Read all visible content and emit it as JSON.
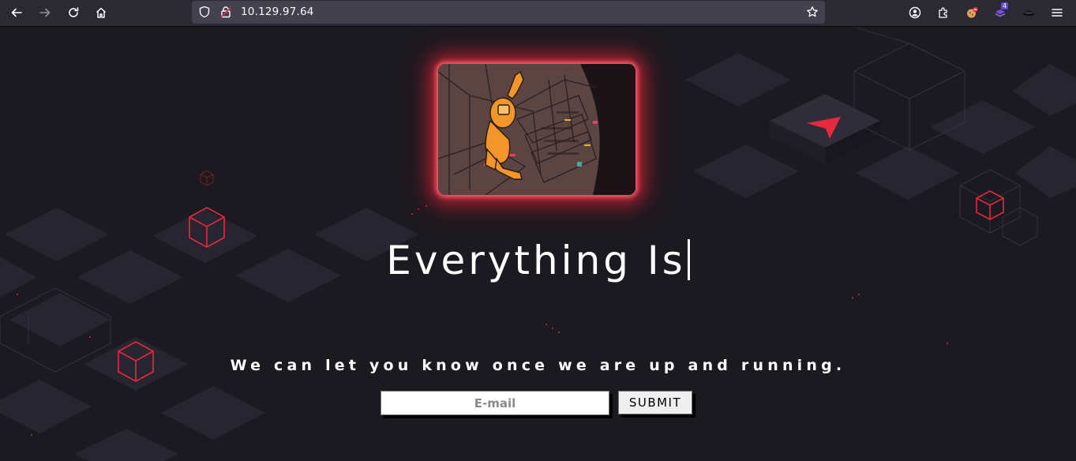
{
  "browser": {
    "url": "10.129.97.64",
    "extension_badge_count": "4",
    "icons": [
      "back-arrow-icon",
      "forward-arrow-icon",
      "reload-icon",
      "home-icon",
      "shield-icon",
      "lock-icon",
      "star-icon",
      "account-icon",
      "extensions-icon",
      "extension-icon",
      "hamburger-menu-icon"
    ]
  },
  "page": {
    "headline": "Everything Is",
    "subline": "We can let you know once we are up and running.",
    "email_placeholder": "E-mail",
    "submit_label": "SUBMIT"
  },
  "colors": {
    "background": "#1b1a20",
    "accent_red": "#e8283c",
    "glow": "#ff4a5c",
    "toolbar": "#2b2a33",
    "urlbar": "#42414d"
  }
}
